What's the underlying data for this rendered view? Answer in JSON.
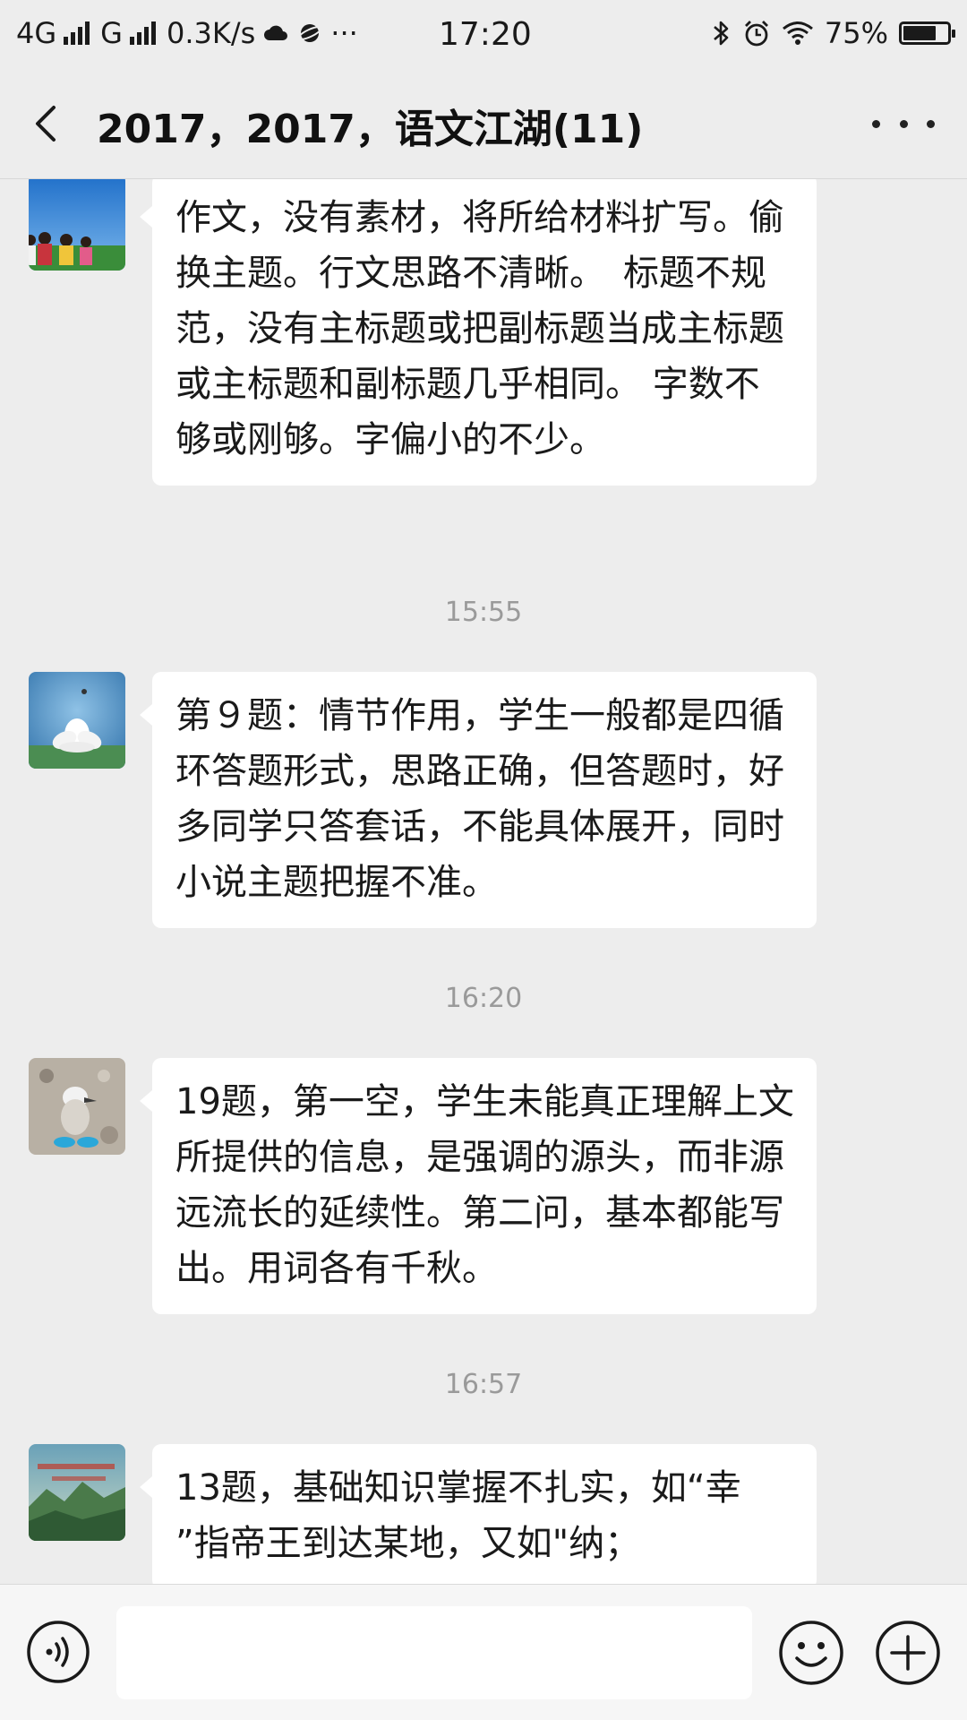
{
  "status_bar": {
    "network1": "4G",
    "network2": "G",
    "speed": "0.3K/s",
    "dots": "···",
    "time": "17:20",
    "battery_percent": "75%",
    "battery_level": 0.75
  },
  "nav": {
    "title": "2017，2017，语文江湖(11)",
    "back_icon": "chevron-left-icon",
    "more_icon": "more-dots-icon"
  },
  "messages": [
    {
      "avatar": "avatar-people-sky",
      "text": "作文，没有素材，将所给材料扩写。偷换主题。行文思路不清晰。　标题不规范，没有主标题或把副标题当成主标题或主标题和副标题几乎相同。 字数不够或刚够。字偏小的不少。"
    },
    {
      "timestamp": "15:55"
    },
    {
      "avatar": "avatar-lotus",
      "text": "第９题：情节作用，学生一般都是四循环答题形式，思路正确，但答题时，好多同学只答套话，不能具体展开，同时小说主题把握不准。"
    },
    {
      "timestamp": "16:20"
    },
    {
      "avatar": "avatar-bird",
      "text": "19题，第一空，学生未能真正理解上文所提供的信息，是强调的源头，而非源远流长的延续性。第二问，基本都能写出。用词各有千秋。"
    },
    {
      "timestamp": "16:57"
    },
    {
      "avatar": "avatar-landscape",
      "text": "13题，基础知识掌握不扎实，如“幸 ”指帝王到达某地，又如\"纳；"
    }
  ],
  "input_bar": {
    "voice_icon": "voice-icon",
    "emoji_icon": "emoji-icon",
    "add_icon": "add-icon",
    "value": ""
  }
}
